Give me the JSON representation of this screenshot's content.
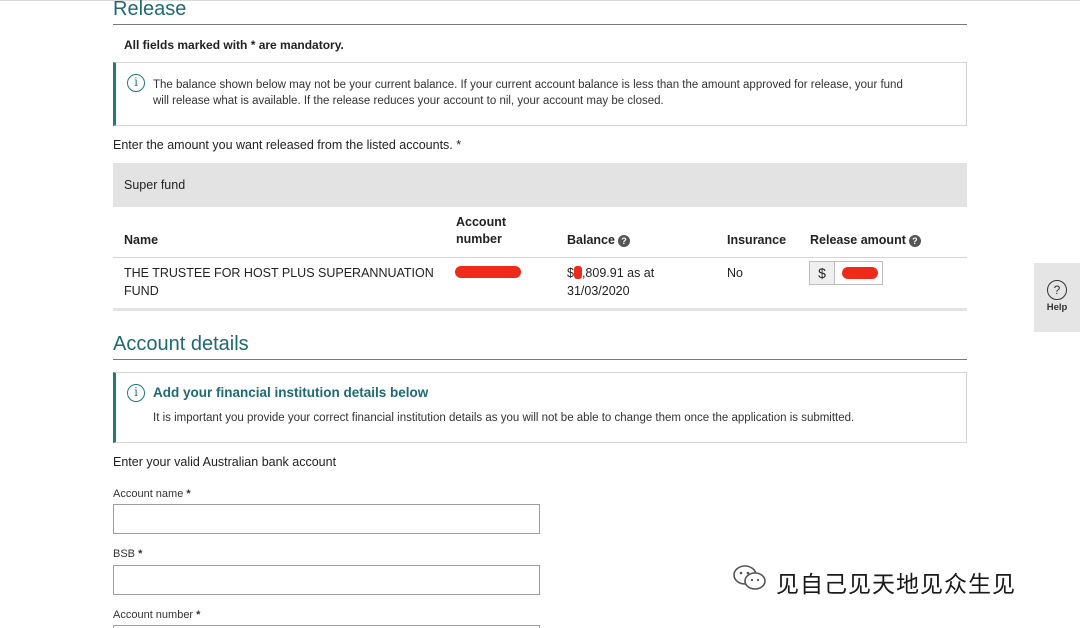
{
  "release": {
    "title": "Release",
    "mandatory_note": "All fields marked with * are mandatory.",
    "info_line1": "The balance shown below may not be your current balance. If your current account balance is less than the amount approved for release, your fund",
    "info_line2": "will release what is available. If the release reduces your account to nil, your account may be closed.",
    "prompt": "Enter the amount you want released from the listed accounts. *",
    "fund_group_label": "Super fund",
    "columns": {
      "name": "Name",
      "account_line1": "Account",
      "account_line2": "number",
      "balance": "Balance",
      "insurance": "Insurance",
      "release_amount": "Release amount"
    },
    "row": {
      "name_line1": "THE TRUSTEE FOR HOST PLUS SUPERANNUATION",
      "name_line2": "FUND",
      "balance_prefix": "$",
      "balance_line1_rest": ",809.91 as at",
      "balance_line2": "31/03/2020",
      "insurance": "No",
      "currency_symbol": "$"
    }
  },
  "account_details": {
    "title": "Account details",
    "info_heading": "Add your financial institution details below",
    "info_text": "It is important you provide your correct financial institution details as you will not be able to change them once the application is submitted.",
    "prompt": "Enter your valid Australian bank account",
    "fields": {
      "account_name_label": "Account name",
      "bsb_label": "BSB",
      "account_number_label": "Account number",
      "required_mark": "*",
      "account_name_value": "",
      "bsb_value": ""
    }
  },
  "help": {
    "icon_char": "?",
    "label": "Help"
  },
  "watermark": {
    "text": "见自己见天地见众生见"
  },
  "icons": {
    "info": "info-icon",
    "question": "question-circle-icon",
    "help": "help-circle-icon",
    "wechat": "wechat-icon"
  },
  "colors": {
    "accent": "#1e6a73",
    "redaction": "#ef2a1a"
  }
}
